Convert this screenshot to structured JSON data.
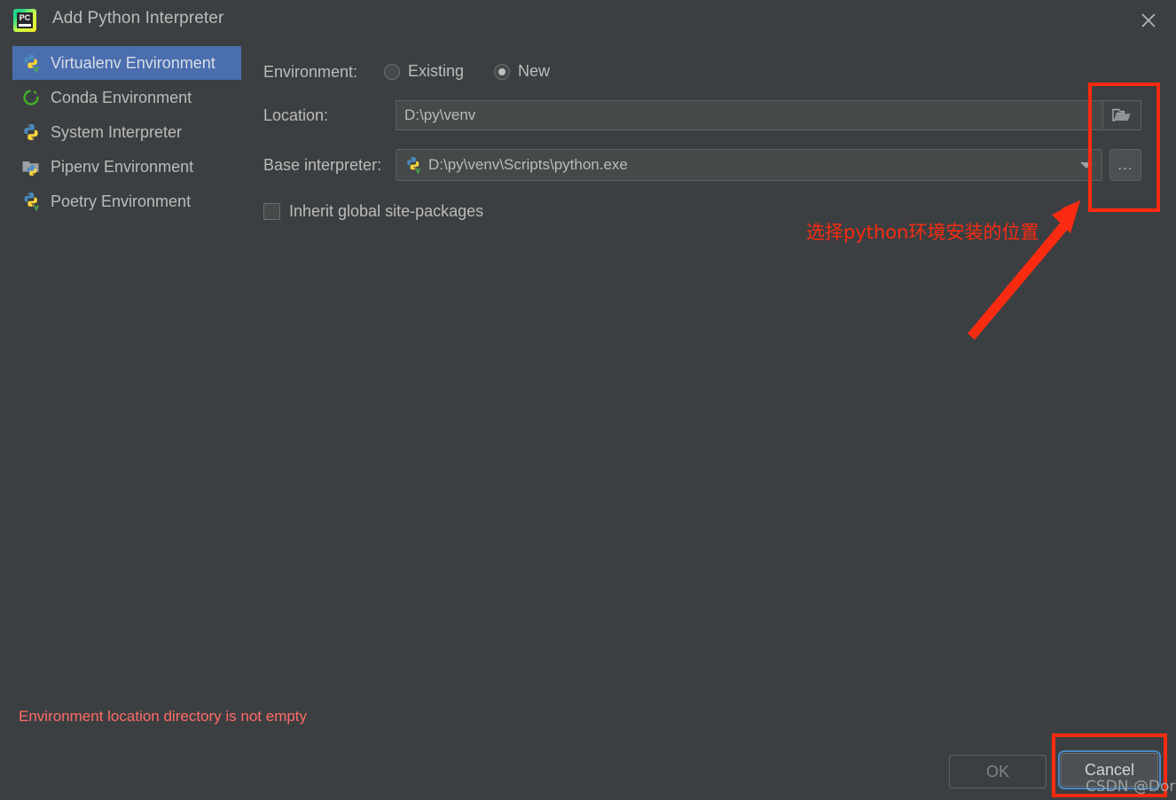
{
  "window": {
    "title": "Add Python Interpreter",
    "app_icon": "pycharm-icon",
    "icon_text": "PC",
    "close_icon": "close-icon"
  },
  "sidebar": {
    "items": [
      {
        "label": "Virtualenv Environment",
        "icon": "python-venv-icon",
        "selected": true
      },
      {
        "label": "Conda Environment",
        "icon": "conda-icon",
        "selected": false
      },
      {
        "label": "System Interpreter",
        "icon": "python-icon",
        "selected": false
      },
      {
        "label": "Pipenv Environment",
        "icon": "pipenv-folder-python-icon",
        "selected": false
      },
      {
        "label": "Poetry Environment",
        "icon": "poetry-python-icon",
        "selected": false
      }
    ]
  },
  "form": {
    "environment_label": "Environment:",
    "radio_existing": "Existing",
    "radio_new": "New",
    "radio_selected": "New",
    "location_label": "Location:",
    "location_value": "D:\\py\\venv",
    "location_browse_icon": "folder-icon",
    "base_interpreter_label": "Base interpreter:",
    "base_interpreter_value": "D:\\py\\venv\\Scripts\\python.exe",
    "base_interpreter_icon": "python-venv-icon",
    "base_interpreter_dropdown_icon": "chevron-down-icon",
    "base_interpreter_more_label": "...",
    "inherit_checkbox_label": "Inherit global site-packages",
    "inherit_checked": false
  },
  "status": {
    "error_message": "Environment location directory is not empty",
    "error_color": "#ff6b68"
  },
  "buttons": {
    "ok": "OK",
    "cancel": "Cancel"
  },
  "annotations": {
    "note_text": "选择python环境安装的位置",
    "note_color": "#fb2b11",
    "highlight_color": "#fb2b11",
    "arrow_icon": "red-arrow-icon",
    "watermark": "CSDN @Dorri闪"
  },
  "theme": {
    "background": "#3c3f41",
    "selection": "#4b6eaf",
    "field_background": "#45494a",
    "text": "#bbbbbb"
  }
}
